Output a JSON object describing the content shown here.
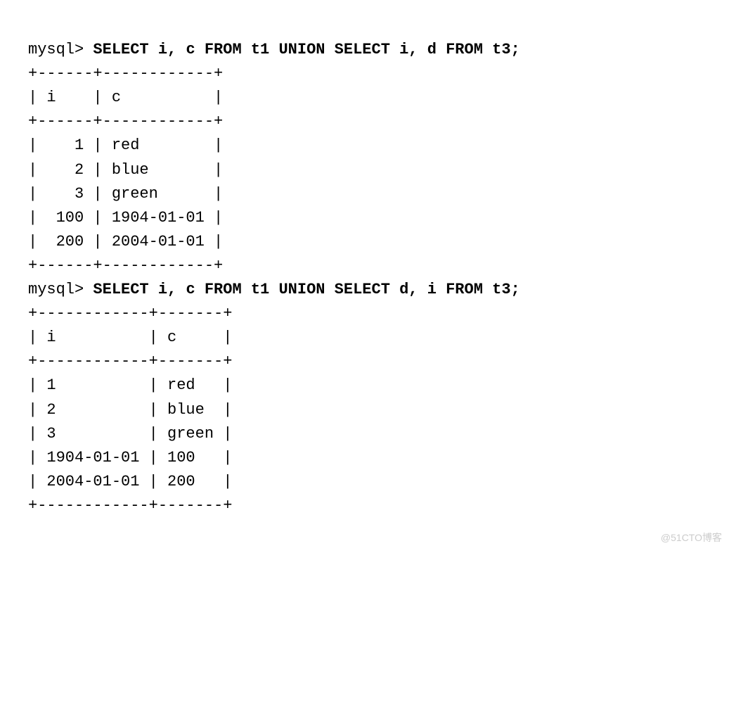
{
  "block1": {
    "prompt": "mysql> ",
    "query": "SELECT i, c FROM t1 UNION SELECT i, d FROM t3;",
    "borderTop": "+------+------------+",
    "header": "| i    | c          |",
    "borderMid": "+------+------------+",
    "rows": [
      "|    1 | red        |",
      "|    2 | blue       |",
      "|    3 | green      |",
      "|  100 | 1904-01-01 |",
      "|  200 | 2004-01-01 |"
    ],
    "borderBot": "+------+------------+"
  },
  "block2": {
    "prompt": "mysql> ",
    "query": "SELECT i, c FROM t1 UNION SELECT d, i FROM t3;",
    "borderTop": "+------------+-------+",
    "header": "| i          | c     |",
    "borderMid": "+------------+-------+",
    "rows": [
      "| 1          | red   |",
      "| 2          | blue  |",
      "| 3          | green |",
      "| 1904-01-01 | 100   |",
      "| 2004-01-01 | 200   |"
    ],
    "borderBot": "+------------+-------+"
  },
  "watermark": "@51CTO博客"
}
